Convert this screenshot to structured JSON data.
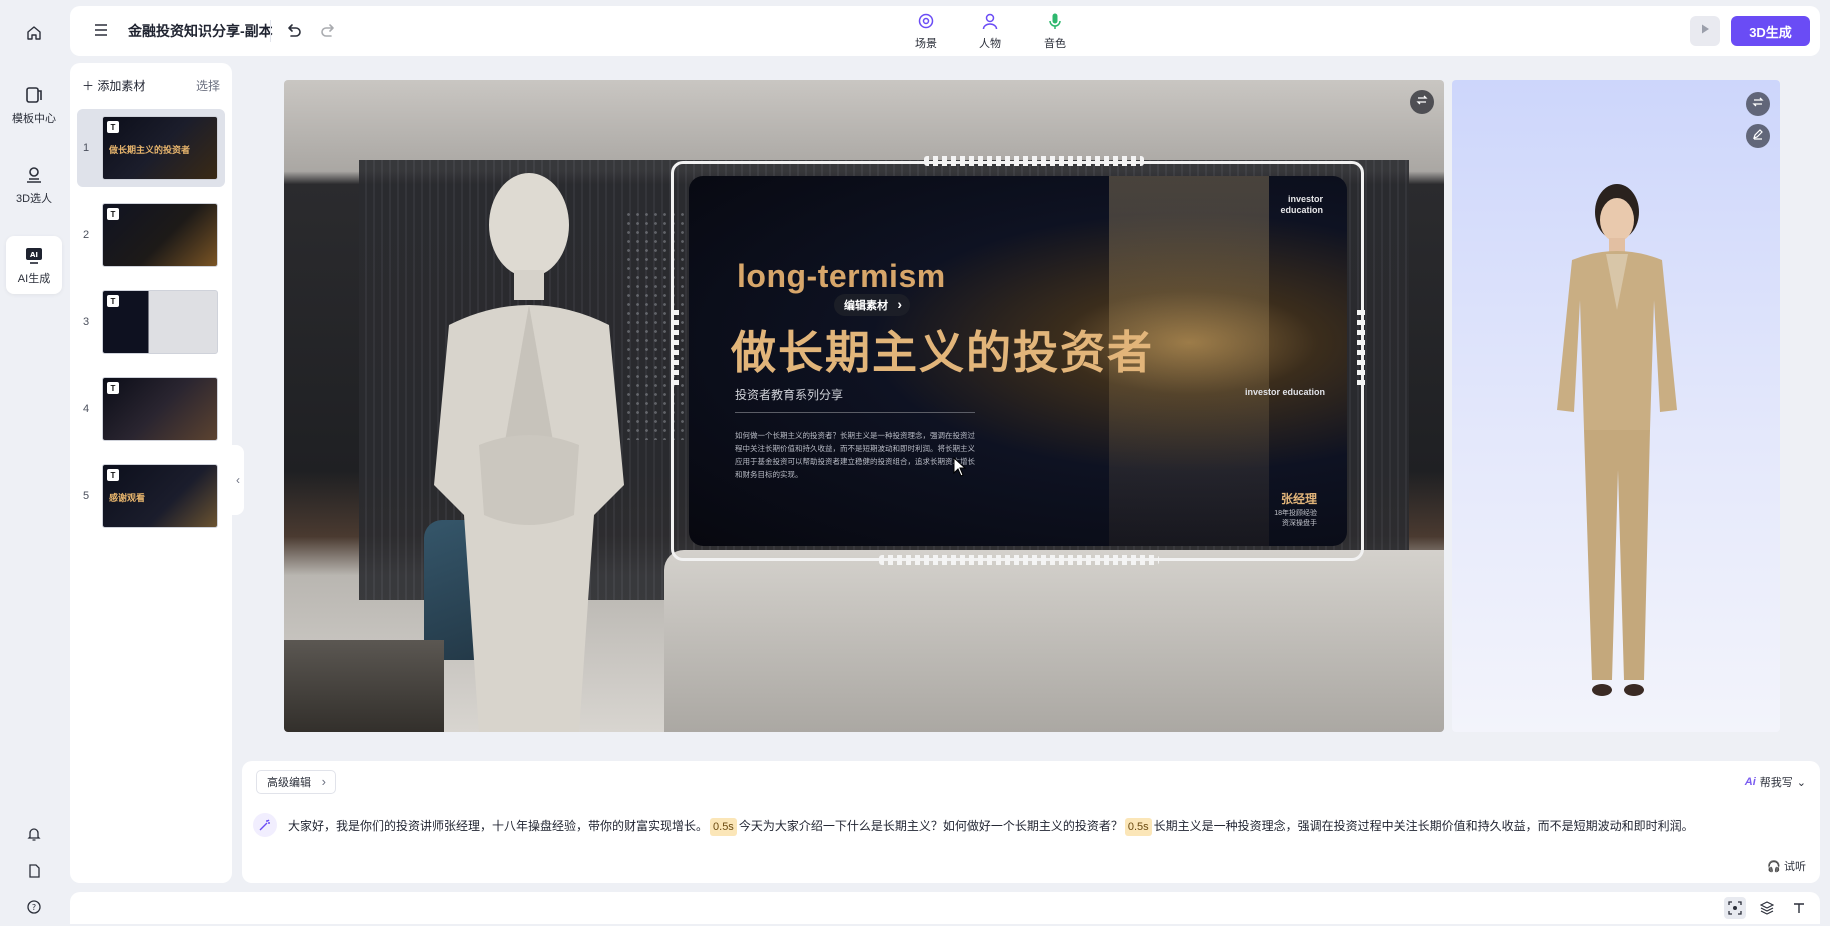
{
  "app": {
    "title": "金融投资知识分享-副本"
  },
  "rail": {
    "items": [
      {
        "label": "模板中心",
        "icon": "template-icon"
      },
      {
        "label": "3D选人",
        "icon": "person-3d-icon"
      },
      {
        "label": "AI生成",
        "icon": "ai-generate-icon",
        "active": true
      }
    ],
    "bottom_icons": [
      "bell-icon",
      "document-icon",
      "help-icon"
    ]
  },
  "toolbar": {
    "center_tabs": [
      {
        "label": "场景",
        "icon": "scene-icon"
      },
      {
        "label": "人物",
        "icon": "person-icon"
      },
      {
        "label": "音色",
        "icon": "microphone-icon"
      }
    ],
    "generate_label": "3D生成",
    "accent_color": "#6a4cf5"
  },
  "slides_panel": {
    "add_label": "添加素材",
    "select_label": "选择",
    "slides": [
      {
        "num": "1",
        "title": "做长期主义的投资者",
        "active": true
      },
      {
        "num": "2",
        "title": ""
      },
      {
        "num": "3",
        "title": ""
      },
      {
        "num": "4",
        "title": ""
      },
      {
        "num": "5",
        "title": "感谢观看"
      }
    ]
  },
  "screen": {
    "en_top": "investor education",
    "big_en": "long-termism",
    "big_cn": "做长期主义的投资者",
    "subtitle": "投资者教育系列分享",
    "body": "如何做一个长期主义的投资者？长期主义是一种投资理念，强调在投资过程中关注长期价值和持久收益，而不是短期波动和即时利润。将长期主义应用于基金投资可以帮助投资者建立稳健的投资组合，追求长期资本增长和财务目标的实现。",
    "mid_en": "investor education",
    "name": "张经理",
    "role_line1": "18年投顾经验",
    "role_line2": "资深操盘手",
    "edit_chip": "编辑素材"
  },
  "editor": {
    "advanced_label": "高级编辑",
    "helper_ai": "Ai",
    "helper_label": "帮我写",
    "script_parts": {
      "p1": "大家好，我是你们的投资讲师张经理，十八年操盘经验，带你的财富实现增长。",
      "pause1": "0.5s",
      "p2": "今天为大家介绍一下什么是长期主义？如何做好一个长期主义的投资者？",
      "pause2": "0.5s",
      "p3": "长期主义是一种投资理念，强调在投资过程中关注长期价值和持久收益，而不是短期波动和即时利润。"
    },
    "listen_label": "试听"
  },
  "bottombar": {
    "icons": [
      "screenshot-icon",
      "layers-icon",
      "text-icon"
    ]
  }
}
